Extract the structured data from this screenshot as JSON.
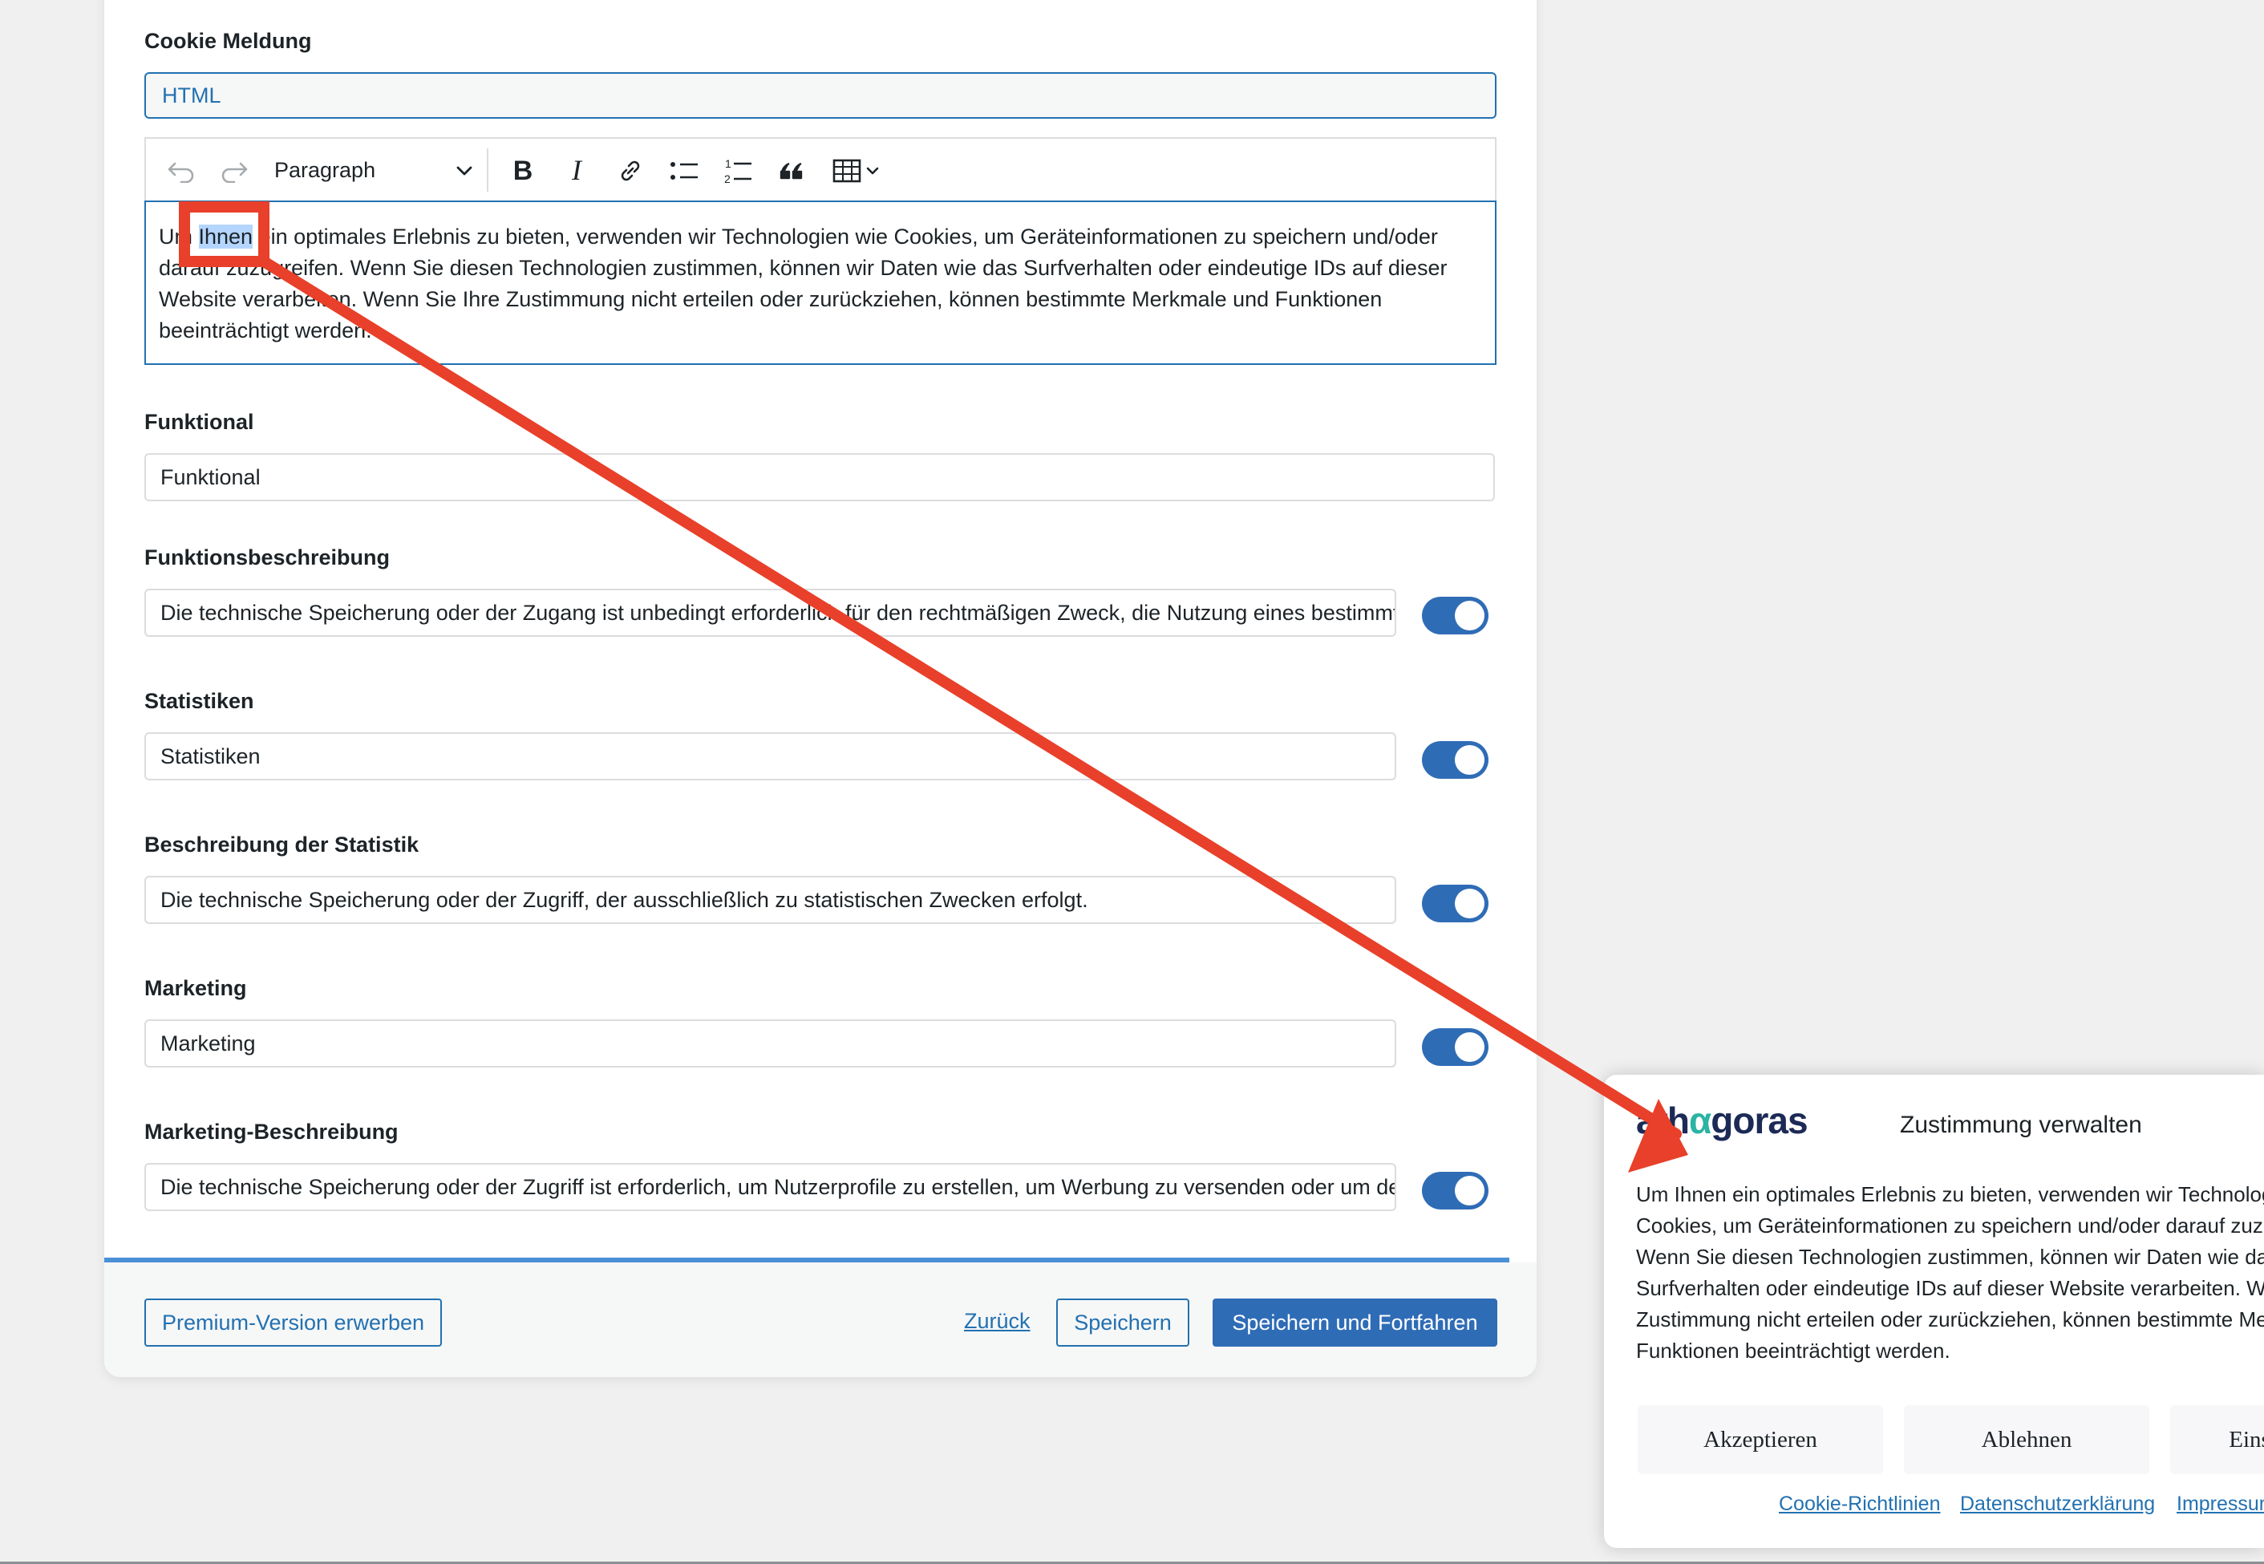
{
  "form": {
    "cookie_label": "Cookie Meldung",
    "cookie_type": "HTML",
    "toolbar": {
      "paragraph": "Paragraph"
    },
    "editor": {
      "line1_pre": "Um ",
      "line1_hl": "Ihnen",
      "line1_post": " ein optimales Erlebnis zu bieten, verwenden wir Technologien wie Cookies, um Geräteinformationen zu speichern und/oder",
      "line2": "darauf zuzugreifen. Wenn Sie diesen Technologien zustimmen, können wir Daten wie das Surfverhalten oder eindeutige IDs auf dieser",
      "line3": "Website verarbeiten. Wenn Sie Ihre Zustimmung nicht erteilen oder zurückziehen, können bestimmte Merkmale und Funktionen",
      "line4": "beeinträchtigt werden."
    },
    "funktional_label": "Funktional",
    "funktional_value": "Funktional",
    "funktionsbeschreibung_label": "Funktionsbeschreibung",
    "funktionsbeschreibung_value": "Die technische Speicherung oder der Zugang ist unbedingt erforderlich für den rechtmäßigen Zweck, die Nutzung eines bestimmten Dienstes zu ermöglichen",
    "statistiken_label": "Statistiken",
    "statistiken_value": "Statistiken",
    "statistik_beschreibung_label": "Beschreibung der Statistik",
    "statistik_beschreibung_value": "Die technische Speicherung oder der Zugriff, der ausschließlich zu statistischen Zwecken erfolgt.",
    "marketing_label": "Marketing",
    "marketing_value": "Marketing",
    "marketing_beschreibung_label": "Marketing-Beschreibung",
    "marketing_beschreibung_value": "Die technische Speicherung oder der Zugriff ist erforderlich, um Nutzerprofile zu erstellen, um Werbung zu versenden oder um den Nutzer"
  },
  "footer": {
    "premium_button": "Premium-Version erwerben",
    "back_link": "Zurück",
    "save_button": "Speichern",
    "save_continue_button": "Speichern und Fortfahren"
  },
  "consent": {
    "logo_pre": "ath",
    "logo_alpha": "α",
    "logo_post": "goras",
    "title": "Zustimmung verwalten",
    "lines": [
      "Um Ihnen ein optimales Erlebnis zu bieten, verwenden wir Technologien wie",
      "Cookies, um Geräteinformationen zu speichern und/oder darauf zuzugreifen.",
      "Wenn Sie diesen Technologien zustimmen, können wir Daten wie das",
      "Surfverhalten oder eindeutige IDs auf dieser Website verarbeiten. Wenn Sie Ihre",
      "Zustimmung nicht erteilen oder zurückziehen, können bestimmte Merkmale und",
      "Funktionen beeinträchtigt werden."
    ],
    "accept_button": "Akzeptieren",
    "reject_button": "Ablehnen",
    "settings_button": "Einstellungen",
    "link_cookie": "Cookie-Richtlinien",
    "link_privacy": "Datenschutzerklärung",
    "link_imprint": "Impressum"
  },
  "colors": {
    "accent": "#2271b1",
    "toggle": "#2f6cb6",
    "annotation": "#e8402a",
    "highlight": "#b4d5fe"
  }
}
